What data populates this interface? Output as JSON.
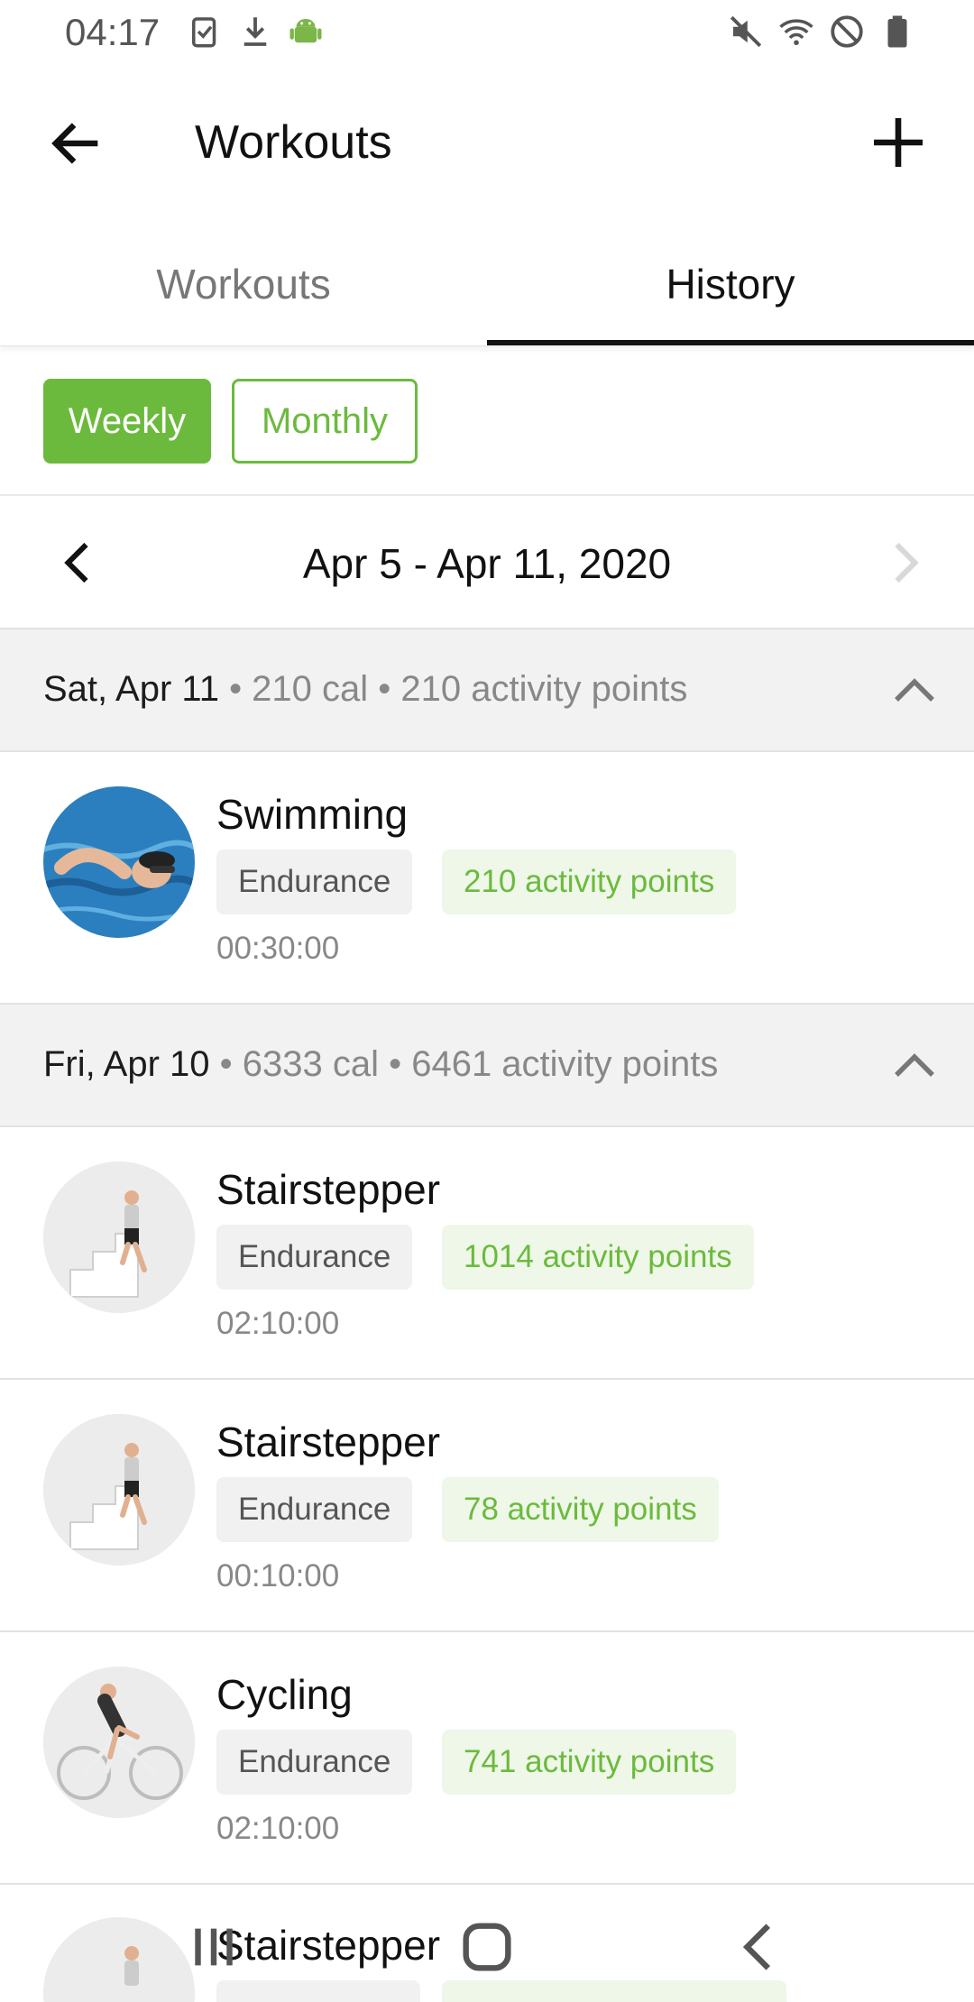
{
  "status_bar": {
    "time": "04:17",
    "left_icons": [
      "clipboard-check-icon",
      "download-icon",
      "android-icon"
    ],
    "right_icons": [
      "mute-icon",
      "wifi-icon",
      "do-not-disturb-icon",
      "battery-icon"
    ]
  },
  "app_bar": {
    "title": "Workouts",
    "back_icon": "arrow-left-icon",
    "add_icon": "plus-icon"
  },
  "tabs": [
    {
      "label": "Workouts",
      "selected": false
    },
    {
      "label": "History",
      "selected": true
    }
  ],
  "filter": {
    "weekly": "Weekly",
    "monthly": "Monthly",
    "selected": "Weekly"
  },
  "date_nav": {
    "range": "Apr 5 - Apr 11, 2020"
  },
  "days": [
    {
      "day": "Sat, Apr 11",
      "meta": " • 210 cal • 210 activity points",
      "workouts": [
        {
          "name": "Swimming",
          "category": "Endurance",
          "points": "210 activity points",
          "duration": "00:30:00",
          "icon": "swimmer-icon"
        }
      ]
    },
    {
      "day": "Fri, Apr 10",
      "meta": " • 6333 cal • 6461 activity points",
      "workouts": [
        {
          "name": "Stairstepper",
          "category": "Endurance",
          "points": "1014 activity points",
          "duration": "02:10:00",
          "icon": "stair-climber-icon"
        },
        {
          "name": "Stairstepper",
          "category": "Endurance",
          "points": "78 activity points",
          "duration": "00:10:00",
          "icon": "stair-climber-icon"
        },
        {
          "name": "Cycling",
          "category": "Endurance",
          "points": "741 activity points",
          "duration": "02:10:00",
          "icon": "cyclist-icon"
        },
        {
          "name": "Stairstepper",
          "icon": "stair-climber-icon"
        }
      ]
    }
  ],
  "colors": {
    "accent": "#6cba3d",
    "accent_light": "#eef7e8",
    "header_bg": "#f2f2f2"
  },
  "nav_bar": [
    "recents-icon",
    "home-icon",
    "back-icon"
  ]
}
